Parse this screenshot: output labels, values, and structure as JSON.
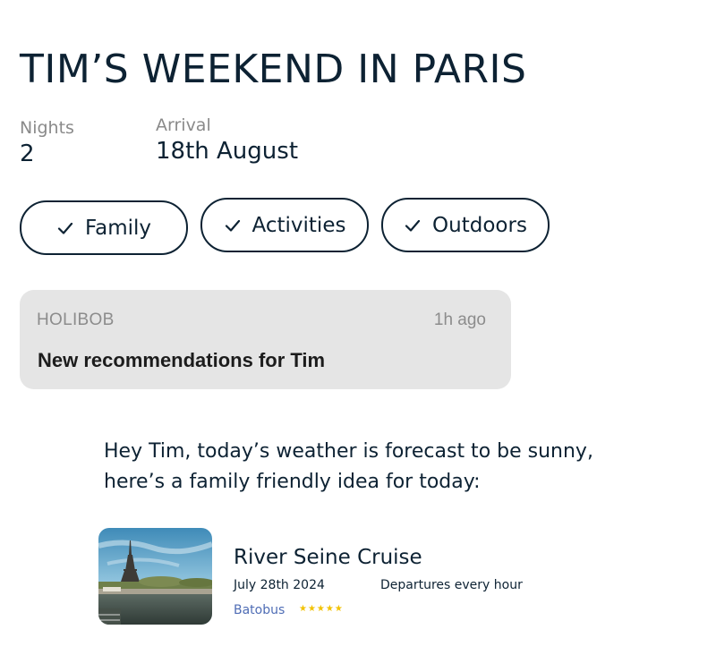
{
  "page": {
    "title": "TIM’S WEEKEND IN PARIS"
  },
  "trip": {
    "nights_label": "Nights",
    "nights_value": "2",
    "arrival_label": "Arrival",
    "arrival_value": "18th August"
  },
  "tags": [
    {
      "label": "Family",
      "icon": "check-icon",
      "selected": true
    },
    {
      "label": "Activities",
      "icon": "check-icon",
      "selected": true
    },
    {
      "label": "Outdoors",
      "icon": "check-icon",
      "selected": true
    }
  ],
  "notification": {
    "app": "HOLIBOB",
    "time": "1h ago",
    "headline": "New recommendations for Tim"
  },
  "message": {
    "text": "Hey Tim, today’s weather is forecast to be sunny, here’s a family friendly idea for today:"
  },
  "recommendation": {
    "name": "River Seine Cruise",
    "date": "July 28th 2024",
    "schedule": "Departures every hour",
    "provider": "Batobus",
    "rating": 5,
    "rating_stars": "★★★★★",
    "image": "eiffel-tower-seine-photo"
  },
  "colors": {
    "primary_text": "#0d2233",
    "muted_text": "#8a8a8a",
    "notification_bg": "#e5e5e5",
    "provider_link": "#4f6db5",
    "star": "#f2c200"
  }
}
